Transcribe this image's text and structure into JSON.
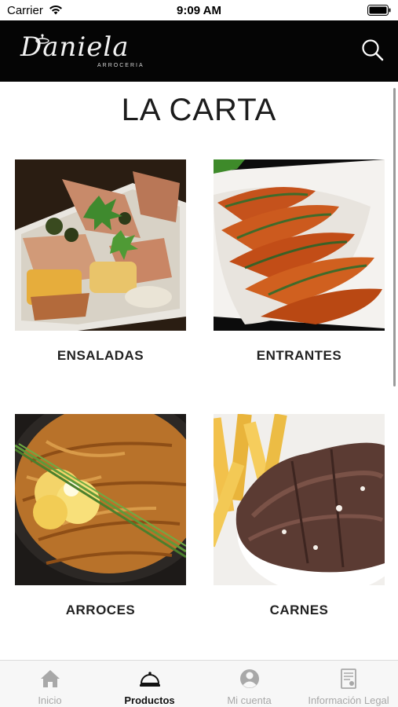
{
  "status_bar": {
    "carrier": "Carrier",
    "time": "9:09 AM"
  },
  "header": {
    "logo_script": "Daniela",
    "logo_subtitle": "ARROCERIA",
    "search_icon": "search-icon"
  },
  "page": {
    "title": "LA CARTA"
  },
  "categories": [
    {
      "label": "ENSALADAS",
      "image": "salad-photo"
    },
    {
      "label": "ENTRANTES",
      "image": "prawns-photo"
    },
    {
      "label": "ARROCES",
      "image": "paella-photo"
    },
    {
      "label": "CARNES",
      "image": "steak-photo"
    }
  ],
  "tab_bar": {
    "active_index": 1,
    "items": [
      {
        "label": "Inicio",
        "icon": "home-icon"
      },
      {
        "label": "Productos",
        "icon": "cloche-icon"
      },
      {
        "label": "Mi cuenta",
        "icon": "account-icon"
      },
      {
        "label": "Información Legal",
        "icon": "legal-document-icon"
      }
    ]
  },
  "colors": {
    "header_bg": "#050505",
    "tab_active": "#111111",
    "tab_inactive": "#a8a8a8"
  }
}
